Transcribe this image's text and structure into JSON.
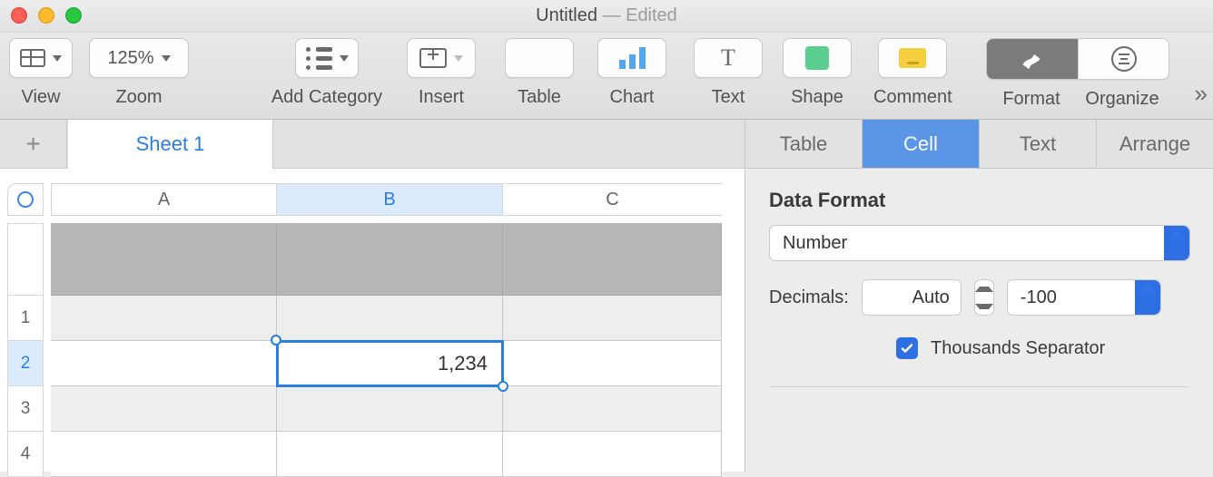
{
  "window": {
    "title": "Untitled",
    "edited_suffix": " — Edited"
  },
  "toolbar": {
    "view": {
      "label": "View"
    },
    "zoom": {
      "label": "Zoom",
      "value": "125%"
    },
    "addcat": {
      "label": "Add Category"
    },
    "insert": {
      "label": "Insert"
    },
    "table": {
      "label": "Table"
    },
    "chart": {
      "label": "Chart"
    },
    "text": {
      "label": "Text"
    },
    "shape": {
      "label": "Shape"
    },
    "comment": {
      "label": "Comment"
    },
    "format": {
      "label": "Format"
    },
    "organize": {
      "label": "Organize"
    }
  },
  "sheets": {
    "tab1": "Sheet 1"
  },
  "grid": {
    "columns": {
      "A": "A",
      "B": "B",
      "C": "C"
    },
    "rows": {
      "r1": "1",
      "r2": "2",
      "r3": "3",
      "r4": "4"
    },
    "selected_cell_value": "1,234"
  },
  "inspector": {
    "tabs": {
      "table": "Table",
      "cell": "Cell",
      "text": "Text",
      "arrange": "Arrange"
    },
    "data_format": {
      "title": "Data Format",
      "format_value": "Number",
      "decimals_label": "Decimals:",
      "decimals_value": "Auto",
      "negative_value": "-100",
      "thousands_label": "Thousands Separator",
      "thousands_checked": true
    }
  }
}
